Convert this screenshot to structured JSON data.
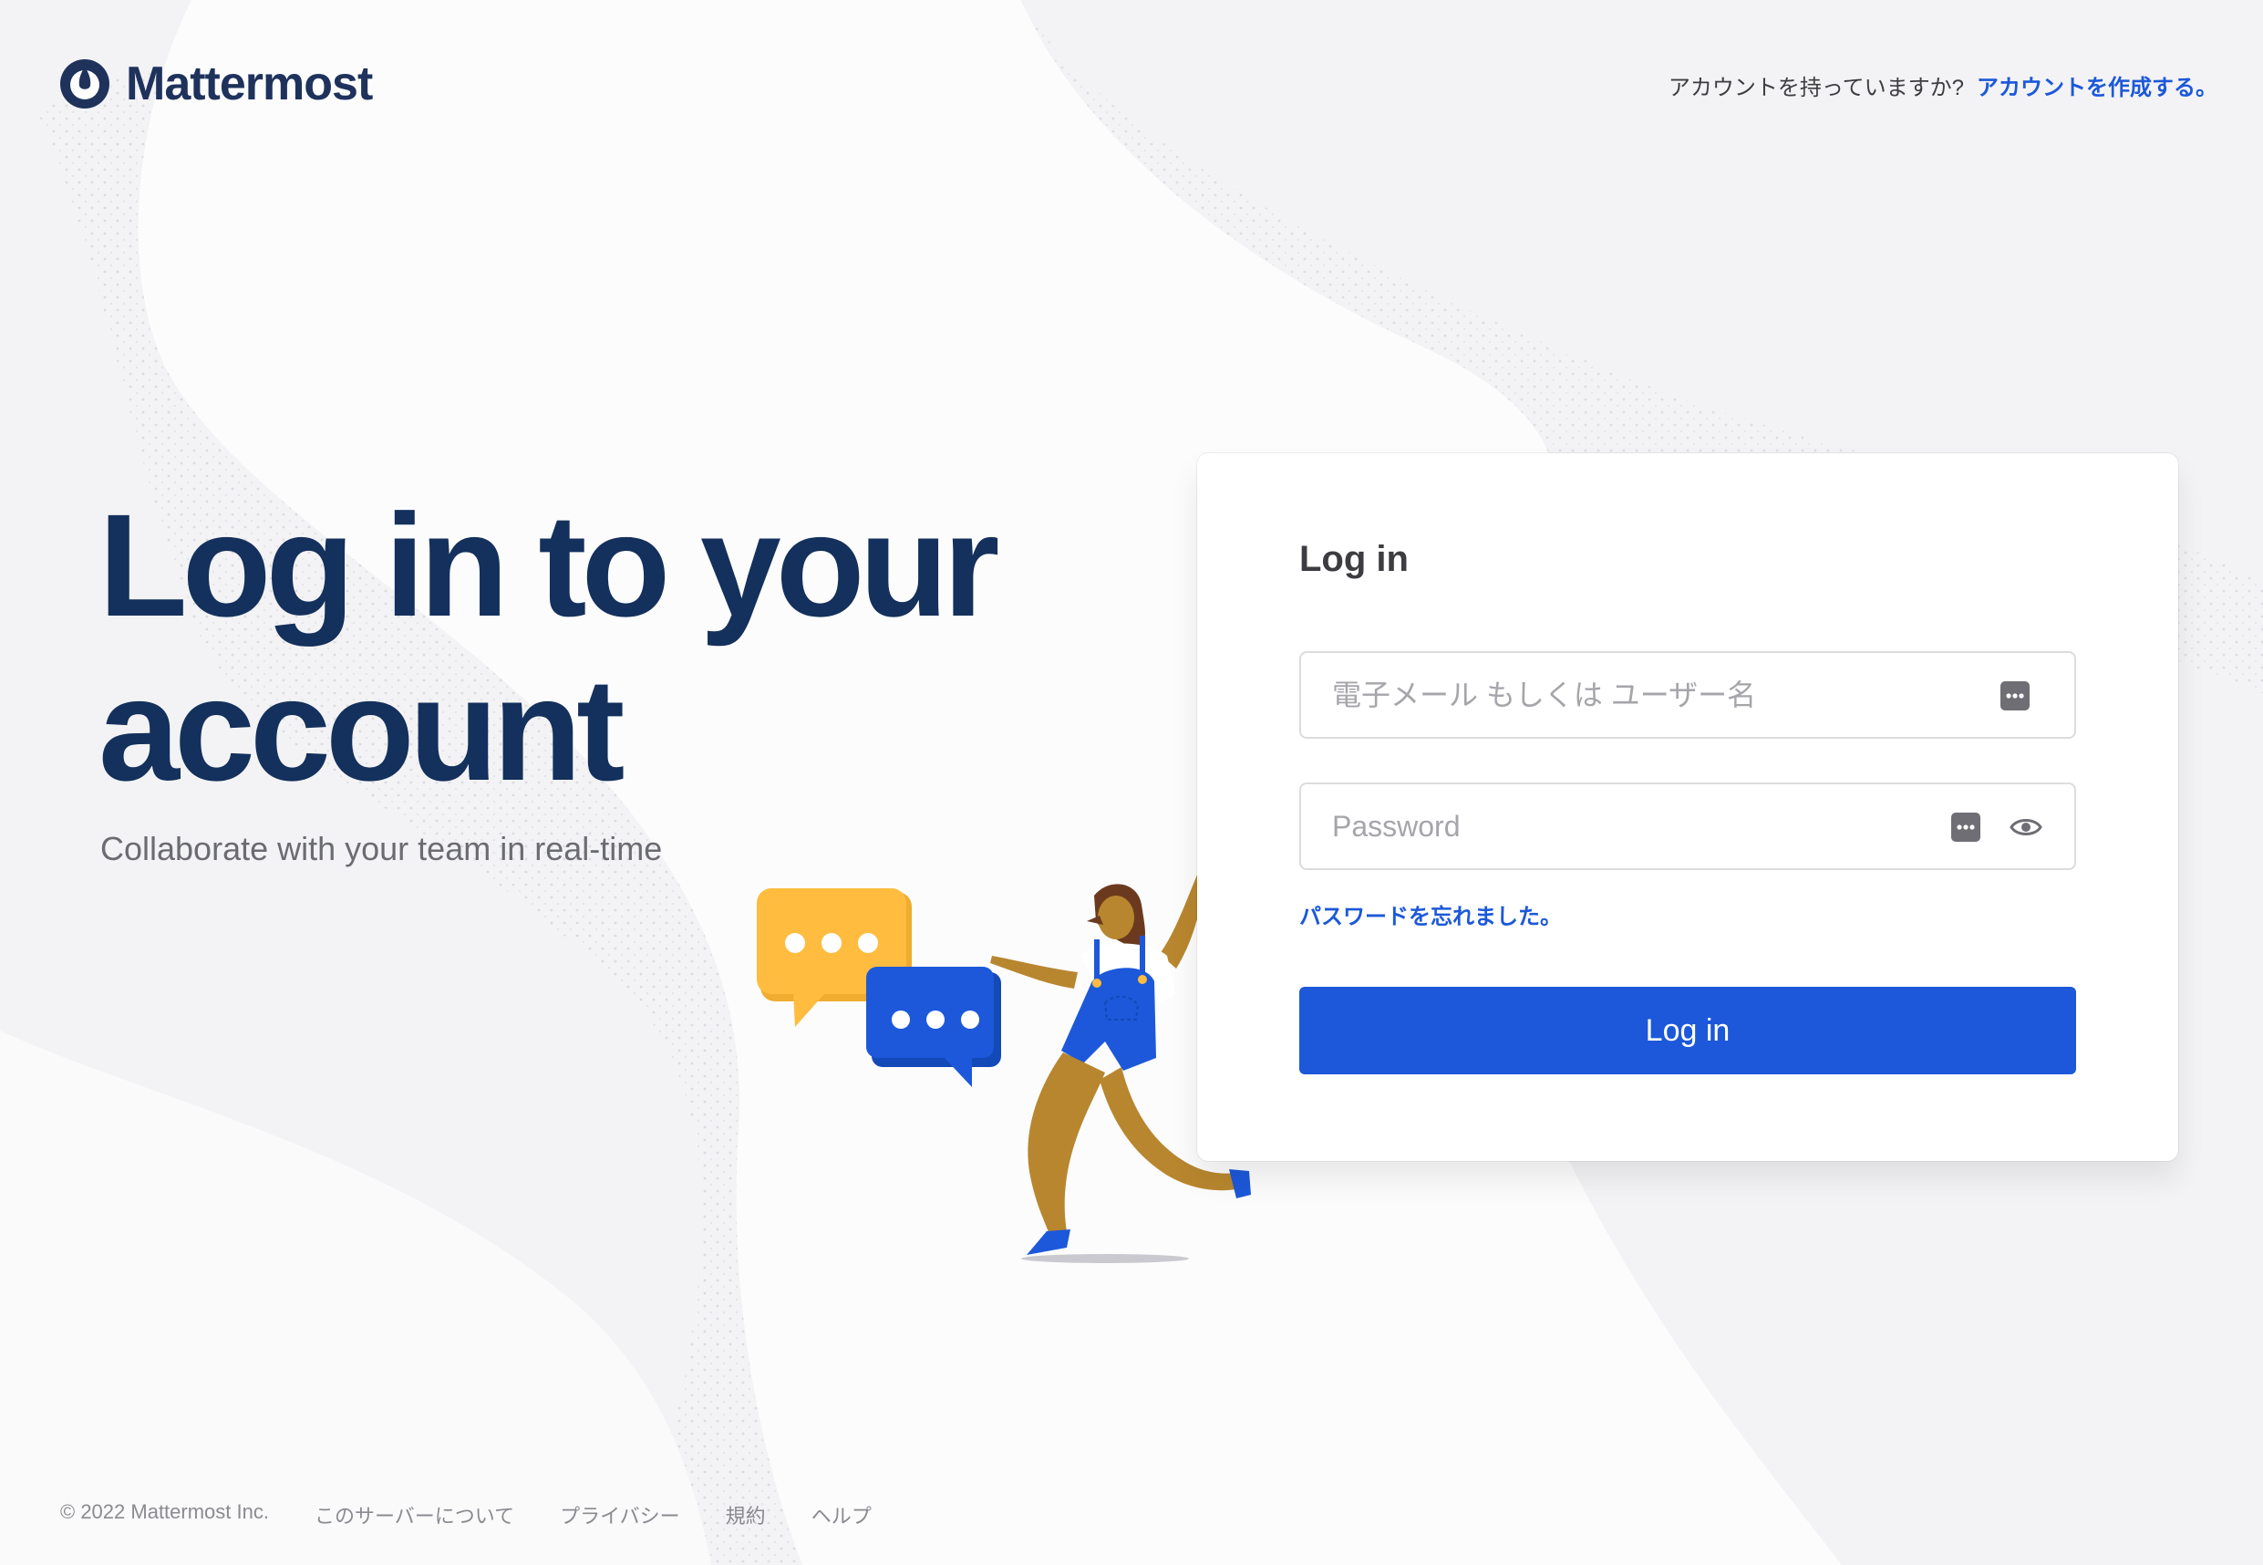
{
  "brand": {
    "name": "Mattermost",
    "primary_color": "#1c58d9",
    "title_color": "#14305c"
  },
  "header": {
    "signup_question": "アカウントを持っていますか?",
    "signup_link": "アカウントを作成する。"
  },
  "hero": {
    "title": "Log in to your account",
    "subtitle": "Collaborate with your team in real-time"
  },
  "login_card": {
    "title": "Log in",
    "email_placeholder": "電子メール もしくは ユーザー名",
    "password_placeholder": "Password",
    "forgot_password": "パスワードを忘れました。",
    "submit_label": "Log in"
  },
  "footer": {
    "copyright": "© 2022 Mattermost Inc.",
    "links": [
      "このサーバーについて",
      "プライバシー",
      "規約",
      "ヘルプ"
    ]
  }
}
